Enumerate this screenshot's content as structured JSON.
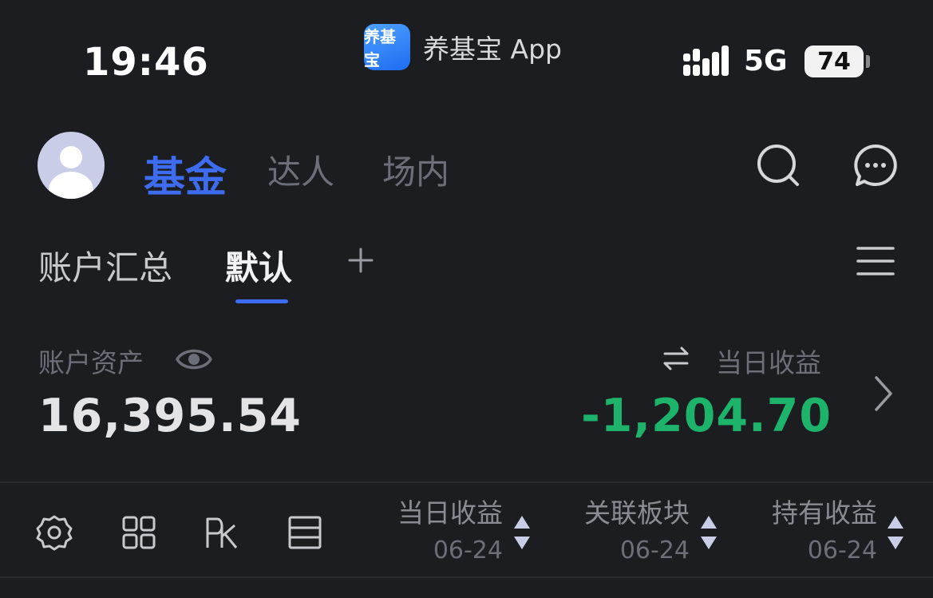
{
  "status_bar": {
    "time": "19:46",
    "app_name": "养基宝 App",
    "app_logo_text": "养基宝",
    "network": "5G",
    "battery": "74"
  },
  "header": {
    "tabs": [
      {
        "label": "基金",
        "active": true
      },
      {
        "label": "达人",
        "active": false
      },
      {
        "label": "场内",
        "active": false
      }
    ],
    "accent_color": "#3d6cf0"
  },
  "account_tabs": {
    "items": [
      {
        "label": "账户汇总",
        "active": false
      },
      {
        "label": "默认",
        "active": true
      }
    ],
    "add_label": "+"
  },
  "summary": {
    "asset_label": "账户资产",
    "asset_value": "16,395.54",
    "pnl_label": "当日收益",
    "pnl_value": "-1,204.70",
    "pnl_color": "#1db36b"
  },
  "columns": [
    {
      "title": "当日收益",
      "date": "06-24"
    },
    {
      "title": "关联板块",
      "date": "06-24"
    },
    {
      "title": "持有收益",
      "date": "06-24"
    }
  ]
}
